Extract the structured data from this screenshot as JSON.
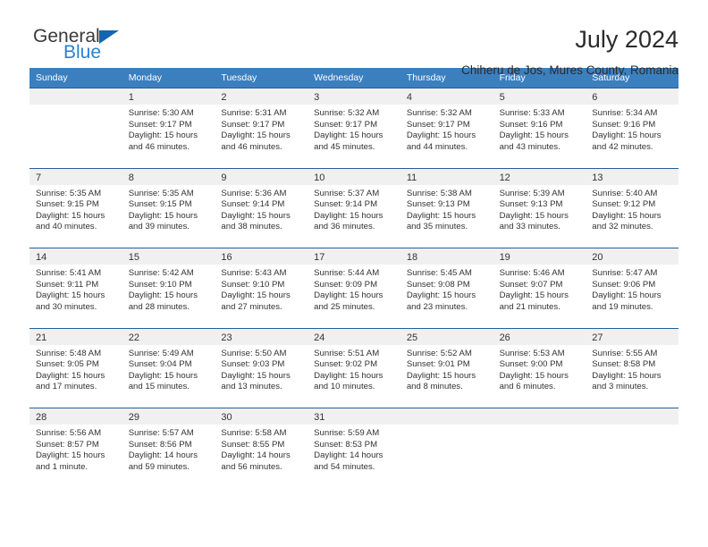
{
  "brand": {
    "name_part1": "General",
    "name_part2": "Blue",
    "accent_color": "#1167b1"
  },
  "header": {
    "title": "July 2024",
    "subtitle": "Chiheru de Jos, Mures County, Romania"
  },
  "calendar": {
    "header_bg": "#3b7fbf",
    "weekdays": [
      "Sunday",
      "Monday",
      "Tuesday",
      "Wednesday",
      "Thursday",
      "Friday",
      "Saturday"
    ],
    "weeks": [
      [
        {
          "day": "",
          "sunrise": "",
          "sunset": "",
          "daylight_line1": "",
          "daylight_line2": ""
        },
        {
          "day": "1",
          "sunrise": "Sunrise: 5:30 AM",
          "sunset": "Sunset: 9:17 PM",
          "daylight_line1": "Daylight: 15 hours",
          "daylight_line2": "and 46 minutes."
        },
        {
          "day": "2",
          "sunrise": "Sunrise: 5:31 AM",
          "sunset": "Sunset: 9:17 PM",
          "daylight_line1": "Daylight: 15 hours",
          "daylight_line2": "and 46 minutes."
        },
        {
          "day": "3",
          "sunrise": "Sunrise: 5:32 AM",
          "sunset": "Sunset: 9:17 PM",
          "daylight_line1": "Daylight: 15 hours",
          "daylight_line2": "and 45 minutes."
        },
        {
          "day": "4",
          "sunrise": "Sunrise: 5:32 AM",
          "sunset": "Sunset: 9:17 PM",
          "daylight_line1": "Daylight: 15 hours",
          "daylight_line2": "and 44 minutes."
        },
        {
          "day": "5",
          "sunrise": "Sunrise: 5:33 AM",
          "sunset": "Sunset: 9:16 PM",
          "daylight_line1": "Daylight: 15 hours",
          "daylight_line2": "and 43 minutes."
        },
        {
          "day": "6",
          "sunrise": "Sunrise: 5:34 AM",
          "sunset": "Sunset: 9:16 PM",
          "daylight_line1": "Daylight: 15 hours",
          "daylight_line2": "and 42 minutes."
        }
      ],
      [
        {
          "day": "7",
          "sunrise": "Sunrise: 5:35 AM",
          "sunset": "Sunset: 9:15 PM",
          "daylight_line1": "Daylight: 15 hours",
          "daylight_line2": "and 40 minutes."
        },
        {
          "day": "8",
          "sunrise": "Sunrise: 5:35 AM",
          "sunset": "Sunset: 9:15 PM",
          "daylight_line1": "Daylight: 15 hours",
          "daylight_line2": "and 39 minutes."
        },
        {
          "day": "9",
          "sunrise": "Sunrise: 5:36 AM",
          "sunset": "Sunset: 9:14 PM",
          "daylight_line1": "Daylight: 15 hours",
          "daylight_line2": "and 38 minutes."
        },
        {
          "day": "10",
          "sunrise": "Sunrise: 5:37 AM",
          "sunset": "Sunset: 9:14 PM",
          "daylight_line1": "Daylight: 15 hours",
          "daylight_line2": "and 36 minutes."
        },
        {
          "day": "11",
          "sunrise": "Sunrise: 5:38 AM",
          "sunset": "Sunset: 9:13 PM",
          "daylight_line1": "Daylight: 15 hours",
          "daylight_line2": "and 35 minutes."
        },
        {
          "day": "12",
          "sunrise": "Sunrise: 5:39 AM",
          "sunset": "Sunset: 9:13 PM",
          "daylight_line1": "Daylight: 15 hours",
          "daylight_line2": "and 33 minutes."
        },
        {
          "day": "13",
          "sunrise": "Sunrise: 5:40 AM",
          "sunset": "Sunset: 9:12 PM",
          "daylight_line1": "Daylight: 15 hours",
          "daylight_line2": "and 32 minutes."
        }
      ],
      [
        {
          "day": "14",
          "sunrise": "Sunrise: 5:41 AM",
          "sunset": "Sunset: 9:11 PM",
          "daylight_line1": "Daylight: 15 hours",
          "daylight_line2": "and 30 minutes."
        },
        {
          "day": "15",
          "sunrise": "Sunrise: 5:42 AM",
          "sunset": "Sunset: 9:10 PM",
          "daylight_line1": "Daylight: 15 hours",
          "daylight_line2": "and 28 minutes."
        },
        {
          "day": "16",
          "sunrise": "Sunrise: 5:43 AM",
          "sunset": "Sunset: 9:10 PM",
          "daylight_line1": "Daylight: 15 hours",
          "daylight_line2": "and 27 minutes."
        },
        {
          "day": "17",
          "sunrise": "Sunrise: 5:44 AM",
          "sunset": "Sunset: 9:09 PM",
          "daylight_line1": "Daylight: 15 hours",
          "daylight_line2": "and 25 minutes."
        },
        {
          "day": "18",
          "sunrise": "Sunrise: 5:45 AM",
          "sunset": "Sunset: 9:08 PM",
          "daylight_line1": "Daylight: 15 hours",
          "daylight_line2": "and 23 minutes."
        },
        {
          "day": "19",
          "sunrise": "Sunrise: 5:46 AM",
          "sunset": "Sunset: 9:07 PM",
          "daylight_line1": "Daylight: 15 hours",
          "daylight_line2": "and 21 minutes."
        },
        {
          "day": "20",
          "sunrise": "Sunrise: 5:47 AM",
          "sunset": "Sunset: 9:06 PM",
          "daylight_line1": "Daylight: 15 hours",
          "daylight_line2": "and 19 minutes."
        }
      ],
      [
        {
          "day": "21",
          "sunrise": "Sunrise: 5:48 AM",
          "sunset": "Sunset: 9:05 PM",
          "daylight_line1": "Daylight: 15 hours",
          "daylight_line2": "and 17 minutes."
        },
        {
          "day": "22",
          "sunrise": "Sunrise: 5:49 AM",
          "sunset": "Sunset: 9:04 PM",
          "daylight_line1": "Daylight: 15 hours",
          "daylight_line2": "and 15 minutes."
        },
        {
          "day": "23",
          "sunrise": "Sunrise: 5:50 AM",
          "sunset": "Sunset: 9:03 PM",
          "daylight_line1": "Daylight: 15 hours",
          "daylight_line2": "and 13 minutes."
        },
        {
          "day": "24",
          "sunrise": "Sunrise: 5:51 AM",
          "sunset": "Sunset: 9:02 PM",
          "daylight_line1": "Daylight: 15 hours",
          "daylight_line2": "and 10 minutes."
        },
        {
          "day": "25",
          "sunrise": "Sunrise: 5:52 AM",
          "sunset": "Sunset: 9:01 PM",
          "daylight_line1": "Daylight: 15 hours",
          "daylight_line2": "and 8 minutes."
        },
        {
          "day": "26",
          "sunrise": "Sunrise: 5:53 AM",
          "sunset": "Sunset: 9:00 PM",
          "daylight_line1": "Daylight: 15 hours",
          "daylight_line2": "and 6 minutes."
        },
        {
          "day": "27",
          "sunrise": "Sunrise: 5:55 AM",
          "sunset": "Sunset: 8:58 PM",
          "daylight_line1": "Daylight: 15 hours",
          "daylight_line2": "and 3 minutes."
        }
      ],
      [
        {
          "day": "28",
          "sunrise": "Sunrise: 5:56 AM",
          "sunset": "Sunset: 8:57 PM",
          "daylight_line1": "Daylight: 15 hours",
          "daylight_line2": "and 1 minute."
        },
        {
          "day": "29",
          "sunrise": "Sunrise: 5:57 AM",
          "sunset": "Sunset: 8:56 PM",
          "daylight_line1": "Daylight: 14 hours",
          "daylight_line2": "and 59 minutes."
        },
        {
          "day": "30",
          "sunrise": "Sunrise: 5:58 AM",
          "sunset": "Sunset: 8:55 PM",
          "daylight_line1": "Daylight: 14 hours",
          "daylight_line2": "and 56 minutes."
        },
        {
          "day": "31",
          "sunrise": "Sunrise: 5:59 AM",
          "sunset": "Sunset: 8:53 PM",
          "daylight_line1": "Daylight: 14 hours",
          "daylight_line2": "and 54 minutes."
        },
        {
          "day": "",
          "sunrise": "",
          "sunset": "",
          "daylight_line1": "",
          "daylight_line2": ""
        },
        {
          "day": "",
          "sunrise": "",
          "sunset": "",
          "daylight_line1": "",
          "daylight_line2": ""
        },
        {
          "day": "",
          "sunrise": "",
          "sunset": "",
          "daylight_line1": "",
          "daylight_line2": ""
        }
      ]
    ]
  }
}
